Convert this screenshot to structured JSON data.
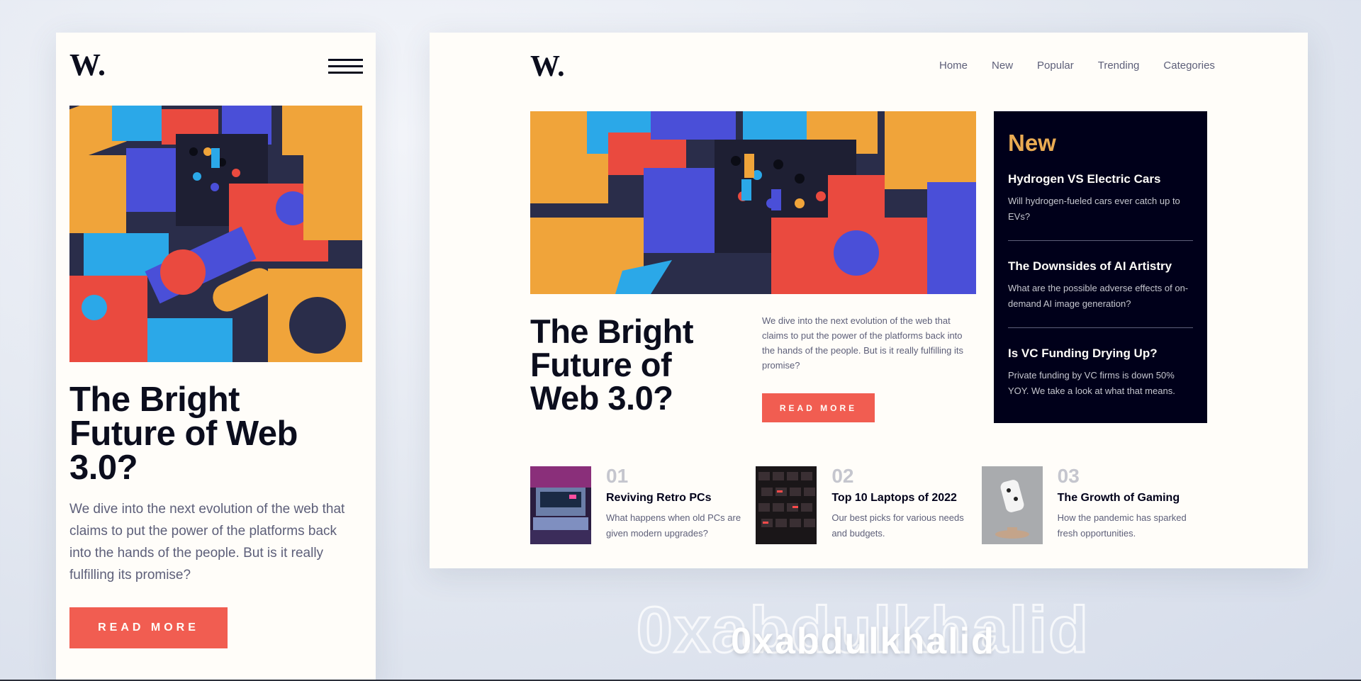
{
  "brand": {
    "logo_text": "W."
  },
  "nav": [
    "Home",
    "New",
    "Popular",
    "Trending",
    "Categories"
  ],
  "hero": {
    "title": "The Bright Future of Web 3.0?",
    "description": "We dive into the next evolution of the web that claims to put the power of the platforms back into the hands of the people. But is it really fulfilling its promise?",
    "button_label": "READ MORE"
  },
  "new_section": {
    "heading": "New",
    "items": [
      {
        "title": "Hydrogen VS Electric Cars",
        "description": "Will hydrogen-fueled cars ever catch up to EVs?"
      },
      {
        "title": "The Downsides of AI Artistry",
        "description": "What are the possible adverse effects of on-demand AI image generation?"
      },
      {
        "title": "Is VC Funding Drying Up?",
        "description": "Private funding by VC firms is down 50% YOY. We take a look at what that means."
      }
    ]
  },
  "features": [
    {
      "number": "01",
      "title": "Reviving Retro PCs",
      "description": "What happens when old PCs are given modern upgrades?"
    },
    {
      "number": "02",
      "title": "Top 10 Laptops of 2022",
      "description": "Our best picks for various needs and budgets."
    },
    {
      "number": "03",
      "title": "The Growth of Gaming",
      "description": "How the pandemic has sparked fresh opportunities."
    }
  ],
  "watermark": "0xabdulkhalid",
  "colors": {
    "accent": "#f15d51",
    "new_heading": "#e9ab53",
    "dark": "#00001a",
    "page": "#fffdf9"
  }
}
